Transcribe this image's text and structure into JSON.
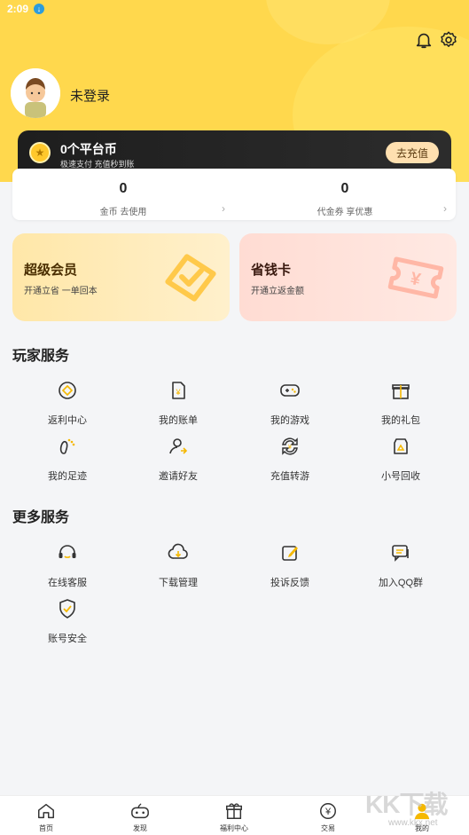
{
  "status": {
    "time": "2:09",
    "indicator_icon": "download-icon"
  },
  "header": {
    "username": "未登录",
    "bell_icon": "bell-icon",
    "settings_icon": "gear-icon"
  },
  "coin_card": {
    "title": "0个平台币",
    "subtitle": "极速支付 充值秒到账",
    "button": "去充值"
  },
  "stats": [
    {
      "value": "0",
      "label": "金币 去使用"
    },
    {
      "value": "0",
      "label": "代金券 享优惠"
    }
  ],
  "promos": [
    {
      "title": "超级会员",
      "subtitle": "开通立省 一单回本"
    },
    {
      "title": "省钱卡",
      "subtitle": "开通立返金额"
    }
  ],
  "player_services": {
    "title": "玩家服务",
    "items": [
      {
        "label": "返利中心",
        "icon": "rebate-icon"
      },
      {
        "label": "我的账单",
        "icon": "bill-icon"
      },
      {
        "label": "我的游戏",
        "icon": "gamepad-icon"
      },
      {
        "label": "我的礼包",
        "icon": "gift-icon"
      },
      {
        "label": "我的足迹",
        "icon": "footprint-icon"
      },
      {
        "label": "邀请好友",
        "icon": "invite-icon"
      },
      {
        "label": "充值转游",
        "icon": "transfer-icon"
      },
      {
        "label": "小号回收",
        "icon": "recycle-icon"
      }
    ]
  },
  "more_services": {
    "title": "更多服务",
    "items": [
      {
        "label": "在线客服",
        "icon": "headset-icon"
      },
      {
        "label": "下载管理",
        "icon": "cloud-download-icon"
      },
      {
        "label": "投诉反馈",
        "icon": "feedback-icon"
      },
      {
        "label": "加入QQ群",
        "icon": "chat-icon"
      },
      {
        "label": "账号安全",
        "icon": "shield-icon"
      }
    ]
  },
  "tabbar": [
    {
      "label": "首页",
      "icon": "home-icon"
    },
    {
      "label": "发现",
      "icon": "discover-icon"
    },
    {
      "label": "福利中心",
      "icon": "gift-icon"
    },
    {
      "label": "交易",
      "icon": "yen-icon"
    },
    {
      "label": "我的",
      "icon": "user-icon"
    }
  ],
  "watermark": {
    "text": "KK下载",
    "url": "www.kkx.net"
  },
  "colors": {
    "accent": "#ffd84d",
    "dark_card": "#1e1e1e",
    "vip_bg": "#ffe7a8",
    "save_bg": "#ffdcd3"
  }
}
